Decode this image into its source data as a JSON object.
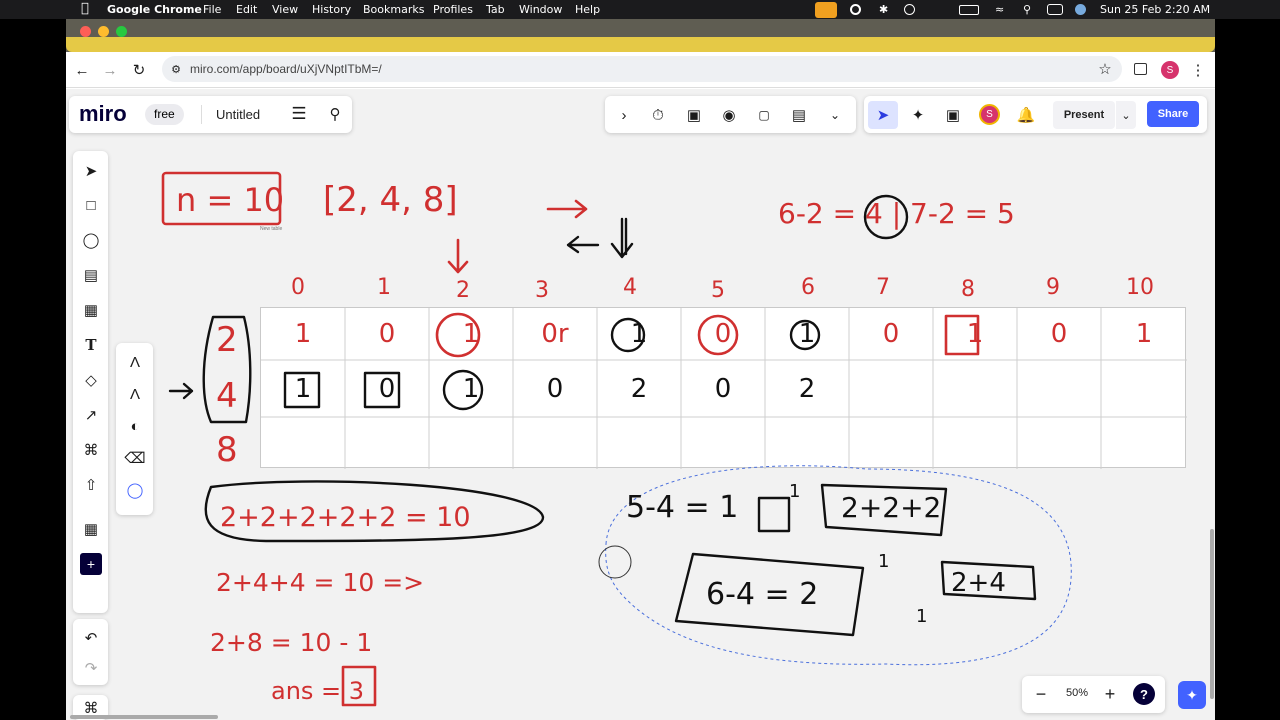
{
  "menubar": {
    "app": "Google Chrome",
    "items": [
      "File",
      "Edit",
      "View",
      "History",
      "Bookmarks",
      "Profiles",
      "Tab",
      "Window",
      "Help"
    ],
    "datetime": "Sun 25 Feb  2:20 AM"
  },
  "browser": {
    "url": "miro.com/app/board/uXjVNptITbM=/",
    "profile_initial": "S"
  },
  "miro": {
    "logo": "miro",
    "plan_badge": "free",
    "board_title": "Untitled",
    "present_label": "Present",
    "share_label": "Share",
    "avatar_initial": "S",
    "zoom": "50%",
    "help": "?"
  },
  "board": {
    "table_label": "New table",
    "headers": [
      "0",
      "1",
      "2",
      "3",
      "4",
      "5",
      "6",
      "7",
      "8",
      "9",
      "10"
    ],
    "row1": [
      "1",
      "0",
      "1",
      "0r",
      "1",
      "0",
      "1",
      "0",
      "1",
      "0",
      "1"
    ],
    "row2": [
      "1",
      "0",
      "1",
      "0",
      "2",
      "0",
      "2",
      "",
      "",
      "",
      ""
    ],
    "row_labels": [
      "2",
      "4",
      "8"
    ],
    "n_label": "n = 10",
    "array_label": "[2, 4, 8]",
    "top_right": "6-2 = 4 | 7-2 = 5",
    "left_formulas": [
      "2+2+2+2+2 = 10",
      "2+4+4 = 10 =>",
      "2+8 = 10  - 1",
      "ans = 3"
    ],
    "right_formulas": [
      "5-4 = 1",
      "2+2+2",
      "6-4 = 2",
      "2+4"
    ],
    "annotations": [
      "1",
      "1",
      "1"
    ]
  }
}
